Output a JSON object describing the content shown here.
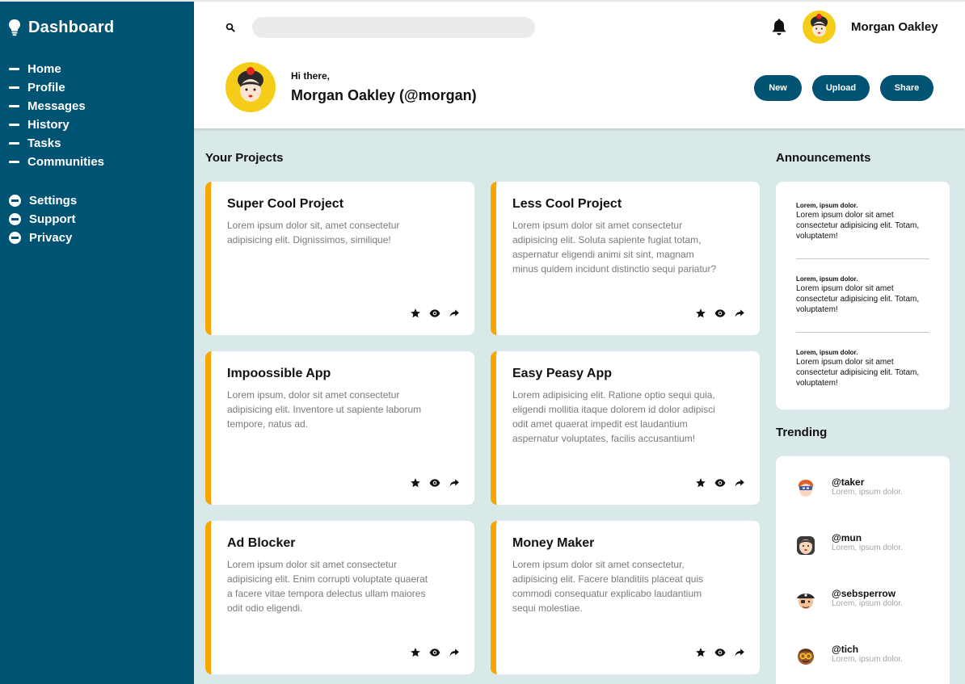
{
  "sidebar": {
    "title": "Dashboard",
    "items": [
      {
        "label": "Home"
      },
      {
        "label": "Profile"
      },
      {
        "label": "Messages"
      },
      {
        "label": "History"
      },
      {
        "label": "Tasks"
      },
      {
        "label": "Communities"
      }
    ],
    "secondary": [
      {
        "label": "Settings"
      },
      {
        "label": "Support"
      },
      {
        "label": "Privacy"
      }
    ]
  },
  "header": {
    "search_placeholder": "",
    "user_name": "Morgan Oakley",
    "greeting": "Hi there,",
    "full_name": "Morgan Oakley (@morgan)",
    "buttons": {
      "new": "New",
      "upload": "Upload",
      "share": "Share"
    }
  },
  "projects": {
    "title": "Your Projects",
    "items": [
      {
        "title": "Super Cool Project",
        "desc": "Lorem ipsum dolor sit, amet consectetur adipisicing elit. Dignissimos, similique!"
      },
      {
        "title": "Less Cool Project",
        "desc": "Lorem ipsum dolor sit amet consectetur adipisicing elit. Soluta sapiente fugiat totam, aspernatur eligendi animi sit sint, magnam minus quidem incidunt distinctio sequi pariatur?"
      },
      {
        "title": "Impoossible App",
        "desc": "Lorem ipsum, dolor sit amet consectetur adipisicing elit. Inventore ut sapiente laborum tempore, natus ad."
      },
      {
        "title": "Easy Peasy App",
        "desc": "Lorem adipisicing elit. Ratione optio sequi quia, eligendi mollitia itaque dolorem id dolor adipisci odit amet quaerat impedit est laudantium aspernatur voluptates, facilis accusantium!"
      },
      {
        "title": "Ad Blocker",
        "desc": "Lorem ipsum dolor sit amet consectetur adipisicing elit. Enim corrupti voluptate quaerat a facere vitae tempora delectus ullam maiores odit odio eligendi."
      },
      {
        "title": "Money Maker",
        "desc": "Lorem ipsum dolor sit amet consectetur, adipisicing elit. Facere blanditiis placeat quis commodi consequatur explicabo laudantium sequi molestiae."
      }
    ]
  },
  "announcements": {
    "title": "Announcements",
    "items": [
      {
        "heading": "Lorem, ipsum dolor.",
        "body": "Lorem ipsum dolor sit amet consectetur adipisicing elit. Totam, voluptatem!"
      },
      {
        "heading": "Lorem, ipsum dolor.",
        "body": "Lorem ipsum dolor sit amet consectetur adipisicing elit. Totam, voluptatem!"
      },
      {
        "heading": "Lorem, ipsum dolor.",
        "body": "Lorem ipsum dolor sit amet consectetur adipisicing elit. Totam, voluptatem!"
      }
    ]
  },
  "trending": {
    "title": "Trending",
    "items": [
      {
        "handle": "@taker",
        "text": "Lorem, ipsum dolor."
      },
      {
        "handle": "@mun",
        "text": "Lorem, ipsum dolor."
      },
      {
        "handle": "@sebsperrow",
        "text": "Lorem, ipsum dolor."
      },
      {
        "handle": "@tich",
        "text": "Lorem, ipsum dolor."
      }
    ]
  },
  "colors": {
    "sidebar": "#015373",
    "accent": "#f9a602",
    "background": "#d9e8e8",
    "button": "#015373"
  }
}
